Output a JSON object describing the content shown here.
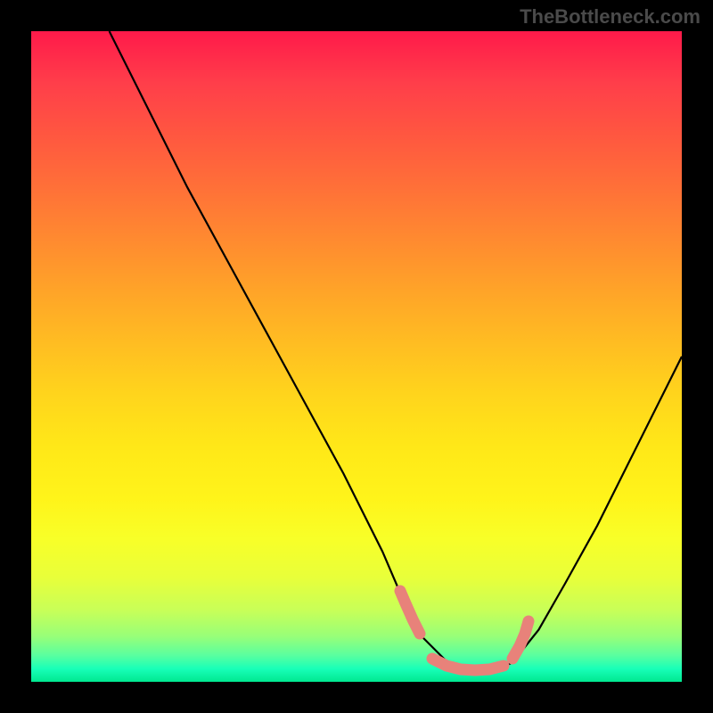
{
  "watermark": "TheBottleneck.com",
  "chart_data": {
    "type": "line",
    "title": "",
    "xlabel": "",
    "ylabel": "",
    "xlim": [
      0,
      100
    ],
    "ylim": [
      0,
      100
    ],
    "series": [
      {
        "name": "bottleneck-curve",
        "color": "#000000",
        "x": [
          12,
          18,
          24,
          30,
          36,
          42,
          48,
          54,
          57,
          60,
          64,
          68,
          72,
          74,
          78,
          82,
          87,
          92,
          98,
          100
        ],
        "y": [
          100,
          88,
          76,
          65,
          54,
          43,
          32,
          20,
          13,
          7,
          3,
          2,
          2,
          3,
          8,
          15,
          24,
          34,
          46,
          50
        ]
      },
      {
        "name": "optimal-band",
        "color": "#e8827a",
        "x": [
          57,
          60,
          64,
          68,
          72,
          74
        ],
        "y": [
          13,
          7,
          3,
          2,
          2,
          3
        ]
      }
    ],
    "grid": false,
    "gradient": {
      "top_color": "#ff1a4a",
      "mid_color": "#ffe818",
      "bottom_color": "#00e890"
    }
  }
}
